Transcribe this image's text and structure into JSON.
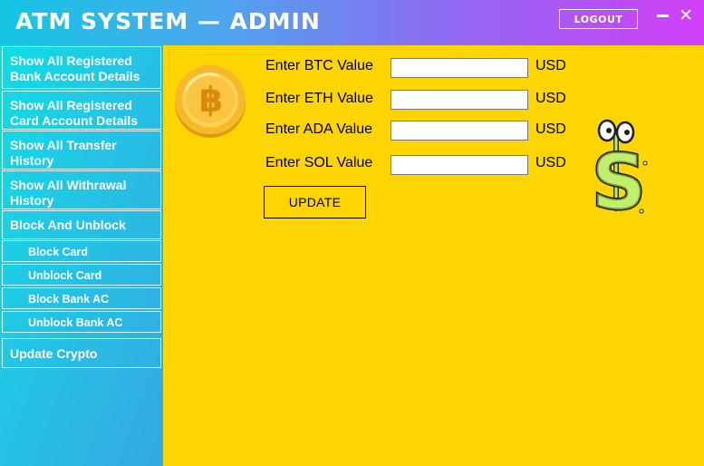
{
  "window": {
    "title": "ATM SYSTEM — ADMIN",
    "logout_label": "LOGOUT",
    "minimize_icon": "minimize-icon",
    "close_glyph": "✕"
  },
  "sidebar": {
    "items": [
      {
        "label": "Show All Registered Bank Account Details"
      },
      {
        "label": "Show All Registered Card Account Details"
      },
      {
        "label": "Show All Transfer History"
      },
      {
        "label": "Show All Withrawal History"
      },
      {
        "label": "Block And Unblock"
      },
      {
        "label": "Block Card"
      },
      {
        "label": "Unblock Card"
      },
      {
        "label": "Block Bank AC"
      },
      {
        "label": "Unblock Bank AC"
      },
      {
        "label": "Update Crypto"
      }
    ]
  },
  "crypto_form": {
    "fields": [
      {
        "label": "Enter BTC Value",
        "value": "",
        "unit": "USD"
      },
      {
        "label": "Enter ETH Value",
        "value": "",
        "unit": "USD"
      },
      {
        "label": "Enter ADA Value",
        "value": "",
        "unit": "USD"
      },
      {
        "label": "Enter SOL Value",
        "value": "",
        "unit": "USD"
      }
    ],
    "update_label": "UPDATE"
  },
  "icons": {
    "bitcoin": "bitcoin-coin-icon",
    "dollar": "dollar-sign-character-icon"
  },
  "colors": {
    "content_bg": "#ffd500",
    "sidebar_start": "#0ddfe4",
    "sidebar_end": "#35a8e3",
    "titlebar_start": "#14c6e3",
    "titlebar_end": "#d23ff7"
  }
}
